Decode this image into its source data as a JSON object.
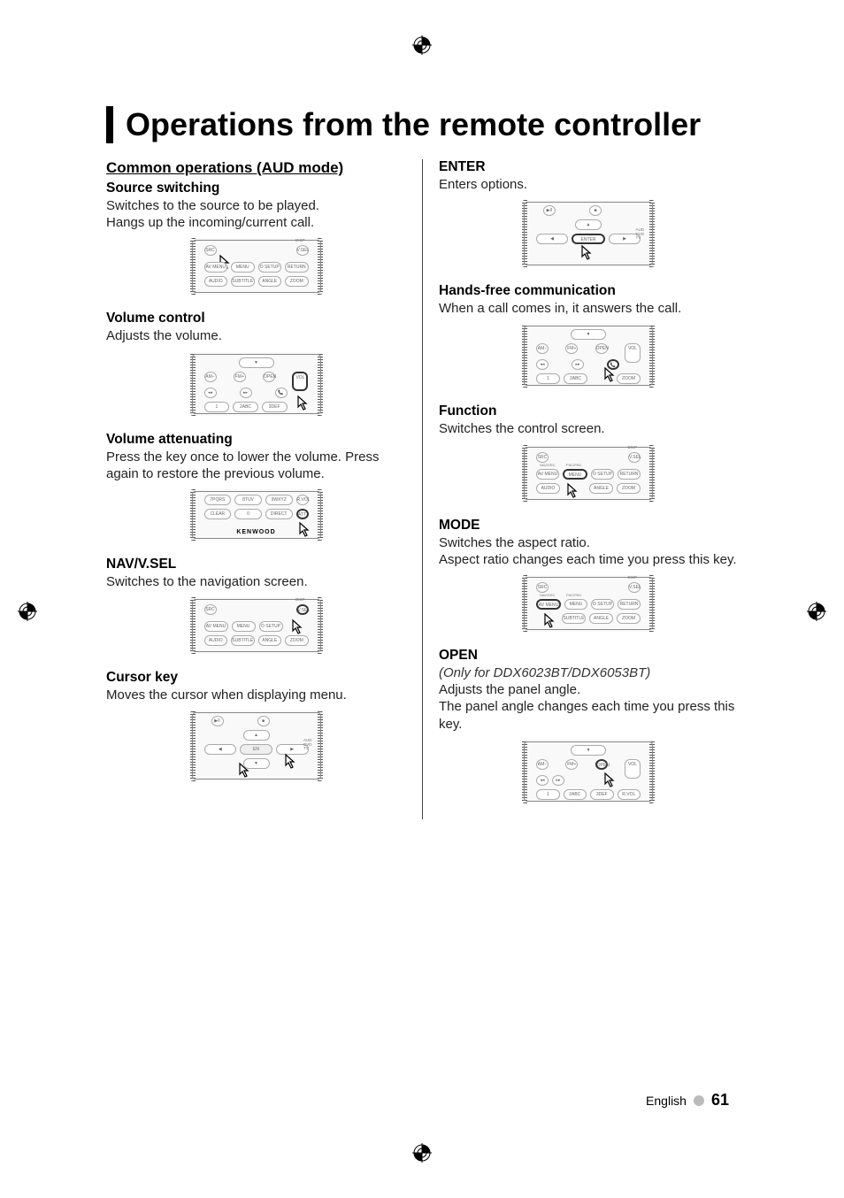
{
  "page": {
    "title": "Operations from the remote controller",
    "language_label": "English",
    "page_number": "61"
  },
  "left_column": {
    "section_heading": "Common operations (AUD mode)",
    "blocks": [
      {
        "title": "Source switching",
        "text": "Switches to the source to be played.\nHangs up the incoming/current call.",
        "figure": "remote-src"
      },
      {
        "title": "Volume control",
        "text": "Adjusts the volume.",
        "figure": "remote-vol"
      },
      {
        "title": "Volume attenuating",
        "text": "Press the key once to lower the volume. Press again to restore the previous volume.",
        "figure": "remote-att"
      },
      {
        "title": "NAV/V.SEL",
        "text": "Switches to the navigation screen.",
        "figure": "remote-nav"
      },
      {
        "title": "Cursor key",
        "text": "Moves the cursor when displaying menu.",
        "figure": "remote-cursor"
      }
    ]
  },
  "right_column": {
    "blocks": [
      {
        "title": "ENTER",
        "text": "Enters options.",
        "figure": "remote-enter"
      },
      {
        "title": "Hands-free communication",
        "text": "When a call comes in, it answers the call.",
        "figure": "remote-handsfree"
      },
      {
        "title": "Function",
        "text": "Switches the control screen.",
        "figure": "remote-function"
      },
      {
        "title": "MODE",
        "text": "Switches the aspect ratio.\nAspect ratio changes each time you press this key.",
        "figure": "remote-mode"
      },
      {
        "title": "OPEN",
        "italic": "(Only for DDX6023BT/DDX6053BT)",
        "text": "Adjusts the panel angle.\nThe panel angle changes each time you press this key.",
        "figure": "remote-open"
      }
    ]
  },
  "remote_labels": {
    "src": "SRC",
    "vsel": "V.SEL",
    "disp": "DISP",
    "navsrc": "NAV/SRC",
    "av_menu": "AV MENU",
    "menu1": "MENU",
    "osetup": "O SETUP",
    "return": "RETURN",
    "audio": "AUDIO",
    "subtitle": "SUBTITLE",
    "angle": "ANGLE",
    "zoom": "ZOOM",
    "am": "AM−",
    "fm": "FM+",
    "open": "OPEN",
    "vol": "VOL",
    "one": "1",
    "two": "2ABC",
    "three": "3DEF",
    "seven": "7PQRS",
    "eight": "8TUV",
    "nine": "9WXYZ",
    "rvol": "R.VOL",
    "clear": "CLEAR",
    "zero": "0",
    "direct": "DIRECT",
    "att": "ATT",
    "brand": "KENWOOD",
    "enter": "ENTER",
    "aud": "AUD",
    "dvd": "DVD",
    "tv": "TV",
    "phone": "📞",
    "fnc_pbc": "FNC/PBC",
    "menu": "MENU",
    "playpause": "▶II",
    "stop": "■",
    "left": "◀",
    "right": "▶",
    "up": "▲",
    "down": "▼"
  }
}
